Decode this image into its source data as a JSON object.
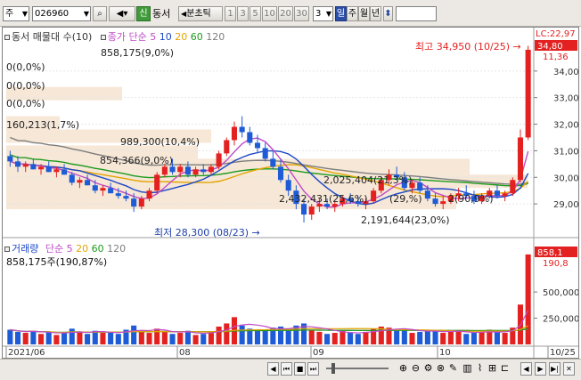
{
  "toolbar": {
    "market": "주",
    "code": "026960",
    "shin_label": "신",
    "stock_name": "동서",
    "mode": "분초틱",
    "intervals": [
      "1",
      "3",
      "5",
      "10",
      "20",
      "30"
    ],
    "interval_value": "3",
    "day_label": "일",
    "week_label": "주",
    "month_label": "월",
    "year_label": "년"
  },
  "price_panel": {
    "legend_title": "동서 매물대 수(10)",
    "legend_ma": "종가 단순",
    "ma_periods": [
      "5",
      "10",
      "20",
      "60",
      "120"
    ],
    "volume_profile_top": "858,175(9,0%)",
    "zero_labels": [
      "0(0,0%)",
      "0(0,0%)",
      "0(0,0%)"
    ],
    "profile_labels": [
      "160,213(1,7%)",
      "989,300(10,4%)",
      "854,366(9,0%)",
      "2,025,404(21,3%)",
      "2,432,431(25,6%)",
      "(29,%)",
      "2(90,9%)",
      "2,191,644(23,0%)"
    ],
    "high_annotation": "최고 34,950 (10/25)",
    "low_annotation": "최저 28,300 (08/23)",
    "axis_ticks": [
      "34,000",
      "33,000",
      "32,000",
      "31,000",
      "30,000",
      "29,000"
    ],
    "axis_header": "LC:22,97",
    "axis_current_price": "34,80",
    "axis_change": "11,36"
  },
  "volume_panel": {
    "legend_title": "거래량",
    "legend_ma": "단순",
    "ma_periods": [
      "5",
      "20",
      "60",
      "120"
    ],
    "value_label": "858,175주(190,87%)",
    "axis_ticks": [
      "500,000",
      "250,000"
    ],
    "axis_current": "858,1",
    "axis_change": "190,8"
  },
  "x_axis": {
    "labels": [
      "2021/06",
      "08",
      "09",
      "10",
      "10/25"
    ]
  },
  "colors": {
    "up": "#e32121",
    "down": "#1e5bd6",
    "ma5": "#c04bc8",
    "ma10": "#1b47c8",
    "ma20": "#e2a400",
    "ma60": "#1c9a1c",
    "ma120": "#7d7d7d",
    "profile": "#f6e7d6"
  },
  "chart_data": {
    "type": "candlestick",
    "dates_first": "2021/06",
    "dates_last": "10/25",
    "price_high": 34950,
    "price_low": 28300,
    "last_close": 34800,
    "last_volume": 858175,
    "candles": [
      [
        30800,
        31000,
        30400,
        30600
      ],
      [
        30600,
        30800,
        30200,
        30400
      ],
      [
        30400,
        30600,
        30200,
        30500
      ],
      [
        30500,
        30700,
        30300,
        30300
      ],
      [
        30300,
        30500,
        30100,
        30400
      ],
      [
        30400,
        30600,
        30200,
        30200
      ],
      [
        30200,
        30400,
        30000,
        30300
      ],
      [
        30300,
        30500,
        30100,
        30100
      ],
      [
        30100,
        30200,
        29700,
        29800
      ],
      [
        29800,
        30000,
        29600,
        29900
      ],
      [
        29900,
        30100,
        29700,
        29700
      ],
      [
        29700,
        29900,
        29400,
        29500
      ],
      [
        29500,
        29700,
        29300,
        29600
      ],
      [
        29600,
        29800,
        29400,
        29400
      ],
      [
        29400,
        29600,
        29200,
        29300
      ],
      [
        29300,
        29500,
        29100,
        29200
      ],
      [
        29200,
        29400,
        28700,
        28900
      ],
      [
        28900,
        29300,
        28800,
        29200
      ],
      [
        29200,
        29600,
        29100,
        29500
      ],
      [
        29500,
        30200,
        29400,
        30100
      ],
      [
        30100,
        30500,
        30000,
        30400
      ],
      [
        30400,
        30700,
        30100,
        30200
      ],
      [
        30200,
        30500,
        30000,
        30400
      ],
      [
        30400,
        30600,
        30000,
        30100
      ],
      [
        30100,
        30400,
        30000,
        30300
      ],
      [
        30300,
        30500,
        30100,
        30200
      ],
      [
        30200,
        30500,
        30100,
        30400
      ],
      [
        30400,
        31000,
        30300,
        30900
      ],
      [
        30900,
        31500,
        30800,
        31400
      ],
      [
        31400,
        32100,
        31200,
        31900
      ],
      [
        31900,
        32300,
        31500,
        31700
      ],
      [
        31700,
        31900,
        31200,
        31300
      ],
      [
        31300,
        31600,
        30900,
        31100
      ],
      [
        31100,
        31300,
        30600,
        30700
      ],
      [
        30700,
        31000,
        30300,
        30400
      ],
      [
        30400,
        30700,
        29800,
        29900
      ],
      [
        29900,
        30100,
        29300,
        29500
      ],
      [
        29500,
        29700,
        28800,
        29000
      ],
      [
        29000,
        29200,
        28300,
        28600
      ],
      [
        28600,
        29000,
        28400,
        28900
      ],
      [
        28900,
        29200,
        28700,
        29000
      ],
      [
        29000,
        29200,
        28800,
        28900
      ],
      [
        28900,
        29100,
        28700,
        29000
      ],
      [
        29000,
        29300,
        28900,
        29200
      ],
      [
        29200,
        29400,
        29000,
        29100
      ],
      [
        29100,
        29300,
        28900,
        29000
      ],
      [
        29000,
        29200,
        28800,
        29100
      ],
      [
        29100,
        29600,
        29000,
        29500
      ],
      [
        29500,
        30000,
        29400,
        29900
      ],
      [
        29900,
        30300,
        29700,
        30100
      ],
      [
        30100,
        30400,
        29900,
        30000
      ],
      [
        30000,
        30200,
        29500,
        29600
      ],
      [
        29600,
        29900,
        29400,
        29800
      ],
      [
        29800,
        30000,
        29400,
        29500
      ],
      [
        29500,
        29700,
        29100,
        29200
      ],
      [
        29200,
        29400,
        28900,
        29000
      ],
      [
        29000,
        29300,
        28800,
        29100
      ],
      [
        29100,
        29400,
        29000,
        29300
      ],
      [
        29300,
        29600,
        29100,
        29400
      ],
      [
        29400,
        29700,
        29200,
        29300
      ],
      [
        29300,
        29500,
        29000,
        29100
      ],
      [
        29100,
        29400,
        29000,
        29300
      ],
      [
        29300,
        29600,
        29200,
        29500
      ],
      [
        29500,
        29700,
        29200,
        29300
      ],
      [
        29300,
        29500,
        29100,
        29400
      ],
      [
        29400,
        30000,
        29300,
        29900
      ],
      [
        29900,
        31800,
        29800,
        31500
      ],
      [
        31500,
        34950,
        31400,
        34800
      ]
    ],
    "volumes": [
      140000,
      120000,
      110000,
      130000,
      100000,
      120000,
      90000,
      110000,
      150000,
      120000,
      100000,
      130000,
      110000,
      120000,
      100000,
      140000,
      180000,
      130000,
      110000,
      150000,
      120000,
      100000,
      110000,
      130000,
      90000,
      100000,
      120000,
      170000,
      200000,
      260000,
      180000,
      150000,
      130000,
      140000,
      160000,
      170000,
      150000,
      180000,
      200000,
      140000,
      120000,
      100000,
      110000,
      130000,
      110000,
      100000,
      120000,
      150000,
      170000,
      160000,
      130000,
      140000,
      110000,
      120000,
      130000,
      140000,
      110000,
      120000,
      130000,
      100000,
      110000,
      120000,
      140000,
      120000,
      110000,
      160000,
      380000,
      858175
    ]
  }
}
